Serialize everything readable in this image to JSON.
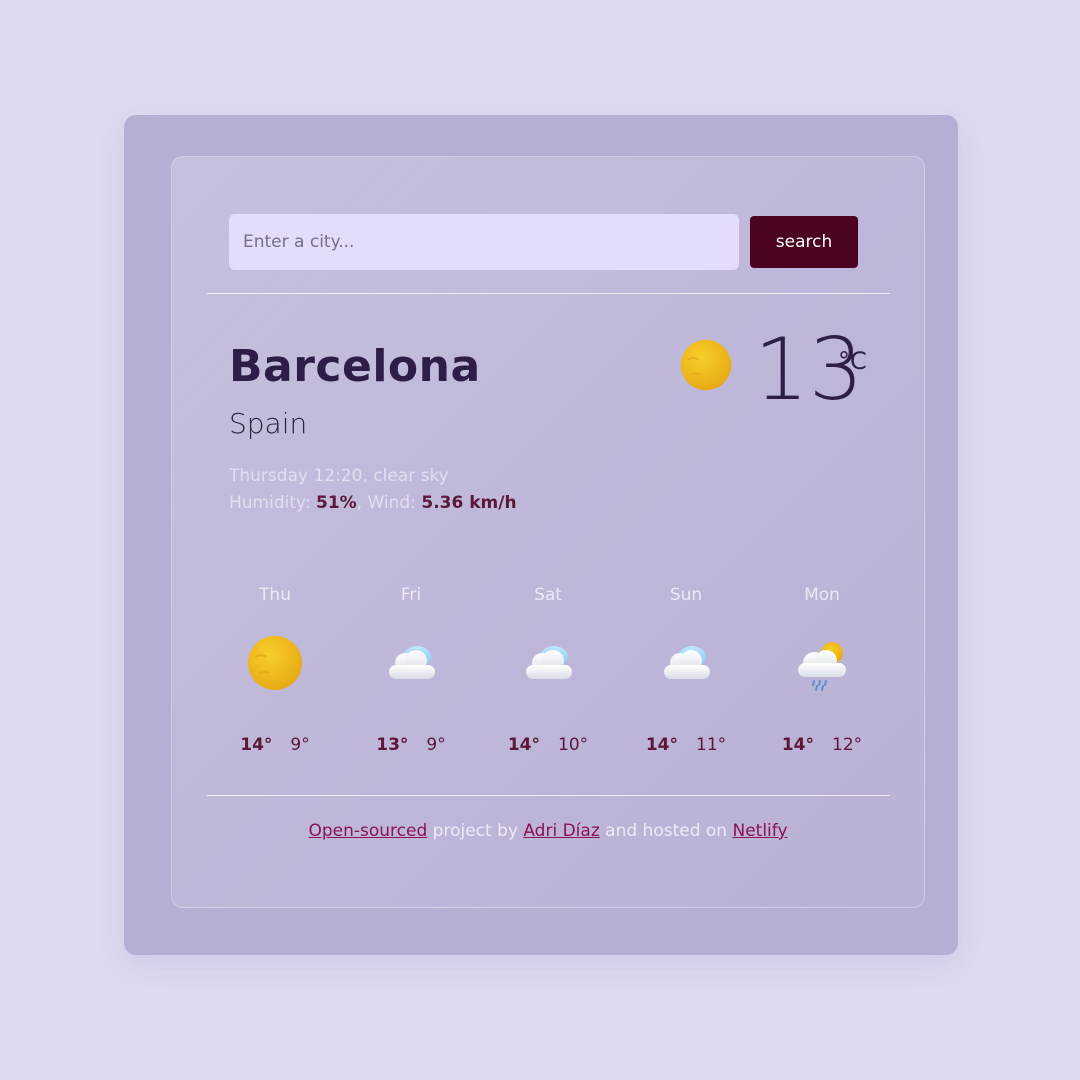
{
  "search": {
    "placeholder": "Enter a city...",
    "value": "",
    "button_label": "search"
  },
  "current": {
    "city": "Barcelona",
    "country": "Spain",
    "datetime_desc": "Thursday 12:20, clear sky",
    "humidity_label": "Humidity: ",
    "humidity_value": "51%",
    "wind_label": ", Wind: ",
    "wind_value": "5.36 km/h",
    "temperature": "13",
    "unit": "°C",
    "icon": "sun-icon"
  },
  "forecast": [
    {
      "day": "Thu",
      "max": "14°",
      "min": "9°",
      "icon": "sun-icon"
    },
    {
      "day": "Fri",
      "max": "13°",
      "min": "9°",
      "icon": "cloud-icon"
    },
    {
      "day": "Sat",
      "max": "14°",
      "min": "10°",
      "icon": "cloud-icon"
    },
    {
      "day": "Sun",
      "max": "14°",
      "min": "11°",
      "icon": "cloud-icon"
    },
    {
      "day": "Mon",
      "max": "14°",
      "min": "12°",
      "icon": "rain-sun-cloud-icon"
    }
  ],
  "footer": {
    "link1": "Open-sourced",
    "text1": " project by ",
    "link2": "Adri Díaz",
    "text2": " and hosted on ",
    "link3": "Netlify"
  },
  "colors": {
    "background": "#dedaf1",
    "card": "#b7aed4",
    "search_button": "#4a0422",
    "accent_text": "#5b1838",
    "link": "#8a1350"
  }
}
